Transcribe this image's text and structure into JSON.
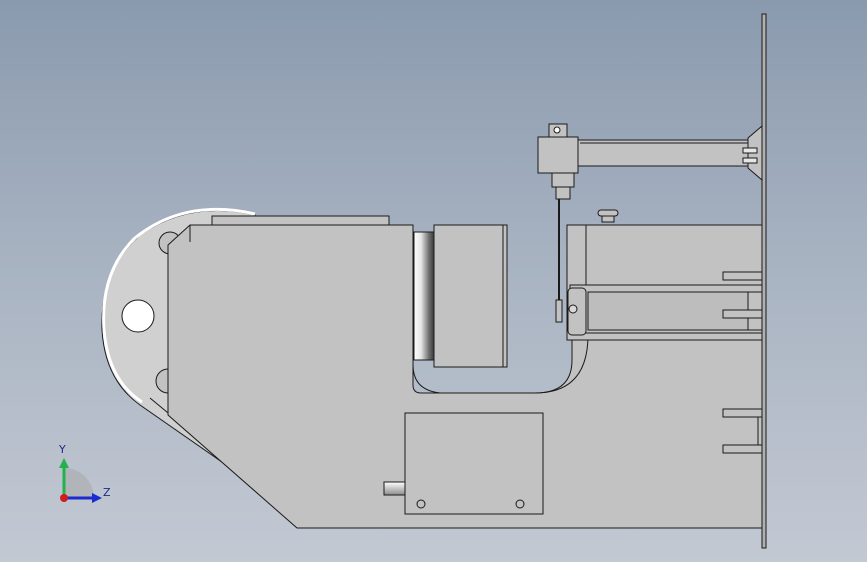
{
  "viewport": {
    "background_top": "#8a9aae",
    "background_bottom": "#c3c9d3"
  },
  "model": {
    "part_fill": "#c2c2c2",
    "part_stroke": "#1a1a1a",
    "shadow_fill": "#a9a9a9"
  },
  "triad": {
    "y_label": "Y",
    "z_label": "Z",
    "y_color": "#22b14c",
    "z_color": "#1c2ad0",
    "x_color": "#d01c1c"
  }
}
